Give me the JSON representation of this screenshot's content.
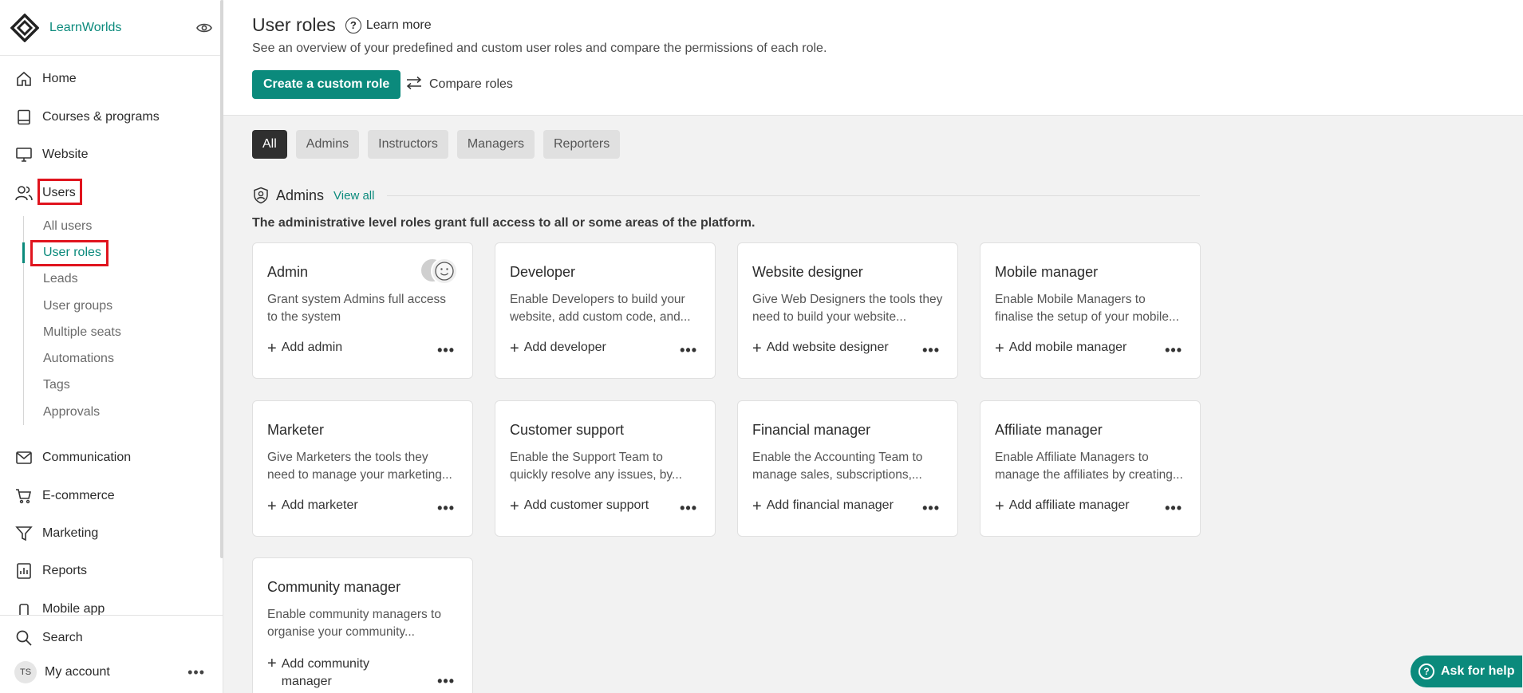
{
  "app": {
    "name": "LearnWorlds"
  },
  "sidebar": {
    "items": [
      {
        "label": "Home",
        "icon": "home-icon"
      },
      {
        "label": "Courses & programs",
        "icon": "book-icon"
      },
      {
        "label": "Website",
        "icon": "monitor-icon"
      },
      {
        "label": "Users",
        "icon": "users-icon"
      },
      {
        "label": "Communication",
        "icon": "mail-icon"
      },
      {
        "label": "E-commerce",
        "icon": "cart-icon"
      },
      {
        "label": "Marketing",
        "icon": "filter-icon"
      },
      {
        "label": "Reports",
        "icon": "chart-icon"
      },
      {
        "label": "Mobile app",
        "icon": "phone-icon"
      }
    ],
    "users_sub": [
      "All users",
      "User roles",
      "Leads",
      "User groups",
      "Multiple seats",
      "Automations",
      "Tags",
      "Approvals"
    ],
    "search_label": "Search",
    "account_label": "My account",
    "account_initials": "TS"
  },
  "header": {
    "title": "User roles",
    "learn_more": "Learn more",
    "subtitle": "See an overview of your predefined and custom user roles and compare the permissions of each role.",
    "create_button": "Create a custom role",
    "compare_button": "Compare roles"
  },
  "filters": [
    "All",
    "Admins",
    "Instructors",
    "Managers",
    "Reporters"
  ],
  "section": {
    "title": "Admins",
    "view_all": "View all",
    "description": "The administrative level roles grant full access to all or some areas of the platform."
  },
  "cards": [
    {
      "title": "Admin",
      "desc": "Grant system Admins full access to the system",
      "add": "Add admin"
    },
    {
      "title": "Developer",
      "desc": "Enable Developers to build your website, add custom code, and...",
      "add": "Add developer"
    },
    {
      "title": "Website designer",
      "desc": "Give Web Designers the tools they need to build your website...",
      "add": "Add website designer"
    },
    {
      "title": "Mobile manager",
      "desc": "Enable Mobile Managers to finalise the setup of your mobile...",
      "add": "Add mobile manager"
    },
    {
      "title": "Marketer",
      "desc": "Give Marketers the tools they need to manage your marketing...",
      "add": "Add marketer"
    },
    {
      "title": "Customer support",
      "desc": "Enable the Support Team to quickly resolve any issues, by...",
      "add": "Add customer support"
    },
    {
      "title": "Financial manager",
      "desc": "Enable the Accounting Team to manage sales, subscriptions,...",
      "add": "Add financial manager"
    },
    {
      "title": "Affiliate manager",
      "desc": "Enable Affiliate Managers to manage the affiliates by creating...",
      "add": "Add affiliate manager"
    },
    {
      "title": "Community manager",
      "desc": "Enable community managers to organise your community...",
      "add": "Add community manager"
    }
  ],
  "help": {
    "label": "Ask for help"
  },
  "colors": {
    "accent": "#0b8a7c",
    "highlight": "#e0141e"
  }
}
